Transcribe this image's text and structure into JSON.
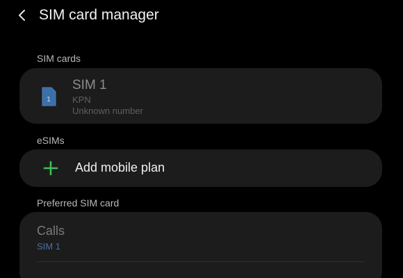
{
  "header": {
    "title": "SIM card manager",
    "back_icon": "chevron-left-icon"
  },
  "sim_cards": {
    "label": "SIM cards",
    "items": [
      {
        "icon": "sim-card-icon",
        "icon_number": "1",
        "name": "SIM 1",
        "carrier": "KPN",
        "number": "Unknown number"
      }
    ]
  },
  "esims": {
    "label": "eSIMs",
    "add_icon": "plus-icon",
    "add_label": "Add mobile plan"
  },
  "preferred": {
    "label": "Preferred SIM card",
    "rows": [
      {
        "title": "Calls",
        "value": "SIM 1"
      }
    ]
  },
  "colors": {
    "background": "#000000",
    "card": "#1c1c1c",
    "accent_green": "#3fbf5a",
    "accent_blue": "#4a6fa0",
    "sim_icon": "#3d6fa8"
  }
}
